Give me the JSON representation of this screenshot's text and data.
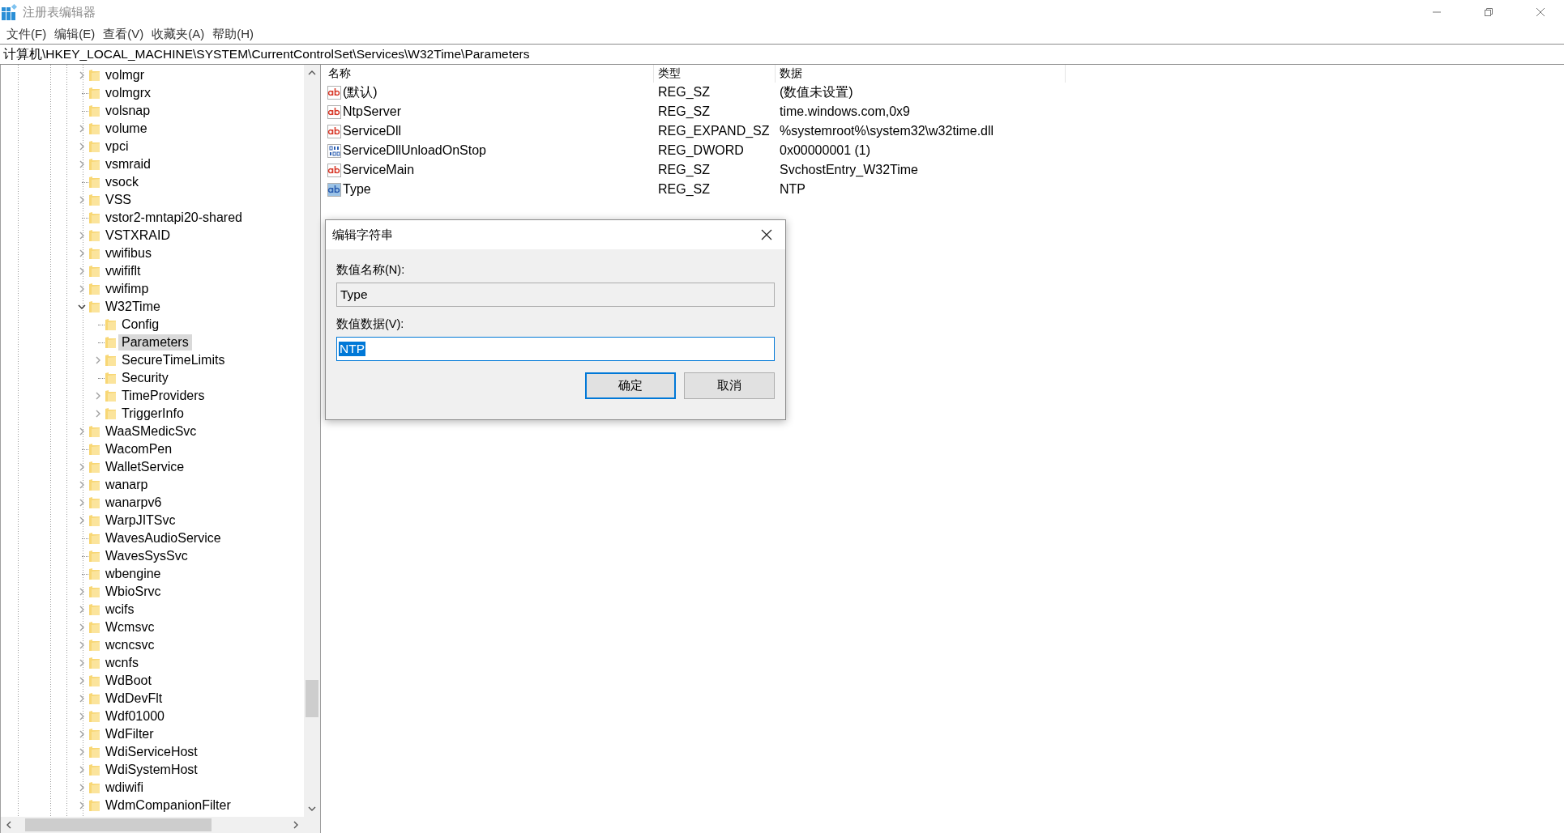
{
  "window": {
    "title": "注册表编辑器"
  },
  "menu": [
    "文件(F)",
    "编辑(E)",
    "查看(V)",
    "收藏夹(A)",
    "帮助(H)"
  ],
  "address": "计算机\\HKEY_LOCAL_MACHINE\\SYSTEM\\CurrentControlSet\\Services\\W32Time\\Parameters",
  "tree": [
    {
      "label": "volmgr",
      "has_children": true,
      "expanded": false,
      "selected": false
    },
    {
      "label": "volmgrx",
      "has_children": false,
      "selected": false
    },
    {
      "label": "volsnap",
      "has_children": false,
      "selected": false
    },
    {
      "label": "volume",
      "has_children": true,
      "expanded": false,
      "selected": false
    },
    {
      "label": "vpci",
      "has_children": true,
      "expanded": false,
      "selected": false
    },
    {
      "label": "vsmraid",
      "has_children": true,
      "expanded": false,
      "selected": false
    },
    {
      "label": "vsock",
      "has_children": false,
      "selected": false
    },
    {
      "label": "VSS",
      "has_children": true,
      "expanded": false,
      "selected": false
    },
    {
      "label": "vstor2-mntapi20-shared",
      "has_children": false,
      "selected": false
    },
    {
      "label": "VSTXRAID",
      "has_children": true,
      "expanded": false,
      "selected": false
    },
    {
      "label": "vwifibus",
      "has_children": true,
      "expanded": false,
      "selected": false
    },
    {
      "label": "vwififlt",
      "has_children": true,
      "expanded": false,
      "selected": false
    },
    {
      "label": "vwifimp",
      "has_children": true,
      "expanded": false,
      "selected": false
    },
    {
      "label": "W32Time",
      "has_children": true,
      "expanded": true,
      "selected": false,
      "children": [
        {
          "label": "Config",
          "has_children": false,
          "selected": false
        },
        {
          "label": "Parameters",
          "has_children": false,
          "selected": true
        },
        {
          "label": "SecureTimeLimits",
          "has_children": true,
          "expanded": false,
          "selected": false
        },
        {
          "label": "Security",
          "has_children": false,
          "selected": false
        },
        {
          "label": "TimeProviders",
          "has_children": true,
          "expanded": false,
          "selected": false
        },
        {
          "label": "TriggerInfo",
          "has_children": true,
          "expanded": false,
          "selected": false
        }
      ]
    },
    {
      "label": "WaaSMedicSvc",
      "has_children": true,
      "expanded": false,
      "selected": false
    },
    {
      "label": "WacomPen",
      "has_children": false,
      "selected": false
    },
    {
      "label": "WalletService",
      "has_children": true,
      "expanded": false,
      "selected": false
    },
    {
      "label": "wanarp",
      "has_children": true,
      "expanded": false,
      "selected": false
    },
    {
      "label": "wanarpv6",
      "has_children": true,
      "expanded": false,
      "selected": false
    },
    {
      "label": "WarpJITSvc",
      "has_children": true,
      "expanded": false,
      "selected": false
    },
    {
      "label": "WavesAudioService",
      "has_children": false,
      "selected": false
    },
    {
      "label": "WavesSysSvc",
      "has_children": false,
      "selected": false
    },
    {
      "label": "wbengine",
      "has_children": false,
      "selected": false
    },
    {
      "label": "WbioSrvc",
      "has_children": true,
      "expanded": false,
      "selected": false
    },
    {
      "label": "wcifs",
      "has_children": true,
      "expanded": false,
      "selected": false
    },
    {
      "label": "Wcmsvc",
      "has_children": true,
      "expanded": false,
      "selected": false
    },
    {
      "label": "wcncsvc",
      "has_children": true,
      "expanded": false,
      "selected": false
    },
    {
      "label": "wcnfs",
      "has_children": true,
      "expanded": false,
      "selected": false
    },
    {
      "label": "WdBoot",
      "has_children": true,
      "expanded": false,
      "selected": false
    },
    {
      "label": "WdDevFlt",
      "has_children": true,
      "expanded": false,
      "selected": false
    },
    {
      "label": "Wdf01000",
      "has_children": true,
      "expanded": false,
      "selected": false
    },
    {
      "label": "WdFilter",
      "has_children": true,
      "expanded": false,
      "selected": false
    },
    {
      "label": "WdiServiceHost",
      "has_children": true,
      "expanded": false,
      "selected": false
    },
    {
      "label": "WdiSystemHost",
      "has_children": true,
      "expanded": false,
      "selected": false
    },
    {
      "label": "wdiwifi",
      "has_children": true,
      "expanded": false,
      "selected": false
    },
    {
      "label": "WdmCompanionFilter",
      "has_children": true,
      "expanded": false,
      "selected": false
    }
  ],
  "values": {
    "columns": [
      "名称",
      "类型",
      "数据"
    ],
    "rows": [
      {
        "kind": "string",
        "name": "(默认)",
        "type": "REG_SZ",
        "data": "(数值未设置)",
        "selected": false
      },
      {
        "kind": "string",
        "name": "NtpServer",
        "type": "REG_SZ",
        "data": "time.windows.com,0x9",
        "selected": false
      },
      {
        "kind": "string",
        "name": "ServiceDll",
        "type": "REG_EXPAND_SZ",
        "data": "%systemroot%\\system32\\w32time.dll",
        "selected": false
      },
      {
        "kind": "binary",
        "name": "ServiceDllUnloadOnStop",
        "type": "REG_DWORD",
        "data": "0x00000001 (1)",
        "selected": false
      },
      {
        "kind": "string",
        "name": "ServiceMain",
        "type": "REG_SZ",
        "data": "SvchostEntry_W32Time",
        "selected": false
      },
      {
        "kind": "string",
        "name": "Type",
        "type": "REG_SZ",
        "data": "NTP",
        "selected": true
      }
    ]
  },
  "dialog": {
    "title": "编辑字符串",
    "name_label": "数值名称(N):",
    "name_value": "Type",
    "data_label": "数值数据(V):",
    "data_value": "NTP",
    "data_text_selected": true,
    "buttons": [
      {
        "label": "确定",
        "default": true
      },
      {
        "label": "取消",
        "default": false
      }
    ]
  }
}
